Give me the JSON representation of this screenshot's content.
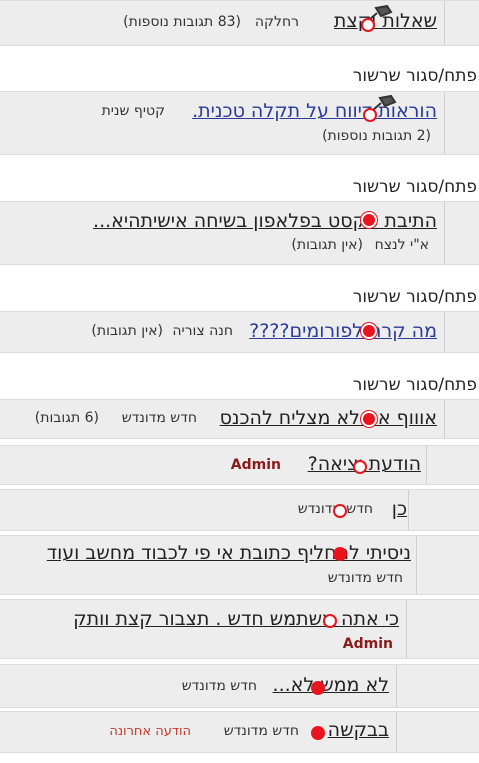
{
  "threads": [
    {
      "title": "שאלות וקצת",
      "author": "רחלקה",
      "replies": "(83 תגובות נוספות)"
    },
    {
      "title": "הוראות דיווח על תקלה טכנית.",
      "author": "קטיף שנית",
      "replies": "(2 תגובות נוספות)"
    },
    {
      "title": "התיבת טקסט בפלאפון בשיחה אישיתהיא...",
      "author": "א\"י לנצח",
      "replies": "(אין תגובות)"
    },
    {
      "title": "מה קרה לפורומים????",
      "author": "חנה צוריה",
      "replies": "(אין תגובות)"
    },
    {
      "title": "אוווף אני לא מצליח להכנס",
      "author": "חדש מדונדש",
      "replies": "(6 תגובות)"
    }
  ],
  "section_toggle": "פתח/סגור שרשור",
  "replies": [
    {
      "title": "הודעת יציאה?",
      "author": "Admin"
    },
    {
      "title": "כן",
      "author": "חדש מדונדש"
    },
    {
      "title": "ניסיתי להחליף כתובת אי פי לכבוד מחשב ועוד",
      "author": "חדש מדונדש"
    },
    {
      "title": "כי אתה משתמש חדש . תצבור קצת וותק",
      "author": "Admin"
    },
    {
      "title": "לא ממש לא...",
      "author": "חדש מדונדש"
    },
    {
      "title": "בבקשה",
      "author": "חדש מדונדש",
      "badge": "הודעה אחרונה"
    }
  ],
  "colors": {
    "row_bg": "#ededed",
    "dot_red": "#e8141e",
    "admin": "#8b1a1a",
    "link_blue": "#2a3a9c"
  },
  "icons": [
    "pushpin-icon",
    "unread-dot-icon",
    "read-dot-icon"
  ]
}
